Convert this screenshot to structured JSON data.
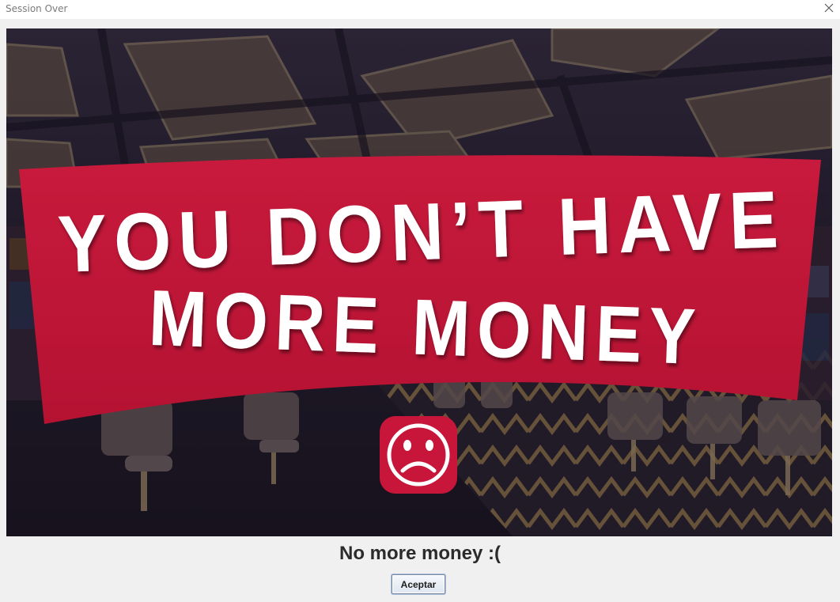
{
  "window": {
    "title": "Session Over"
  },
  "image": {
    "banner_line_1": "YOU DON’T HAVE",
    "banner_line_2": "MORE MONEY",
    "icon": "sad-face-icon",
    "colors": {
      "banner": "#c8163a",
      "icon_bg": "#c8163a",
      "backdrop": "#1d1a2a"
    }
  },
  "dialog": {
    "message": "No more money :(",
    "ok_label": "Aceptar"
  }
}
